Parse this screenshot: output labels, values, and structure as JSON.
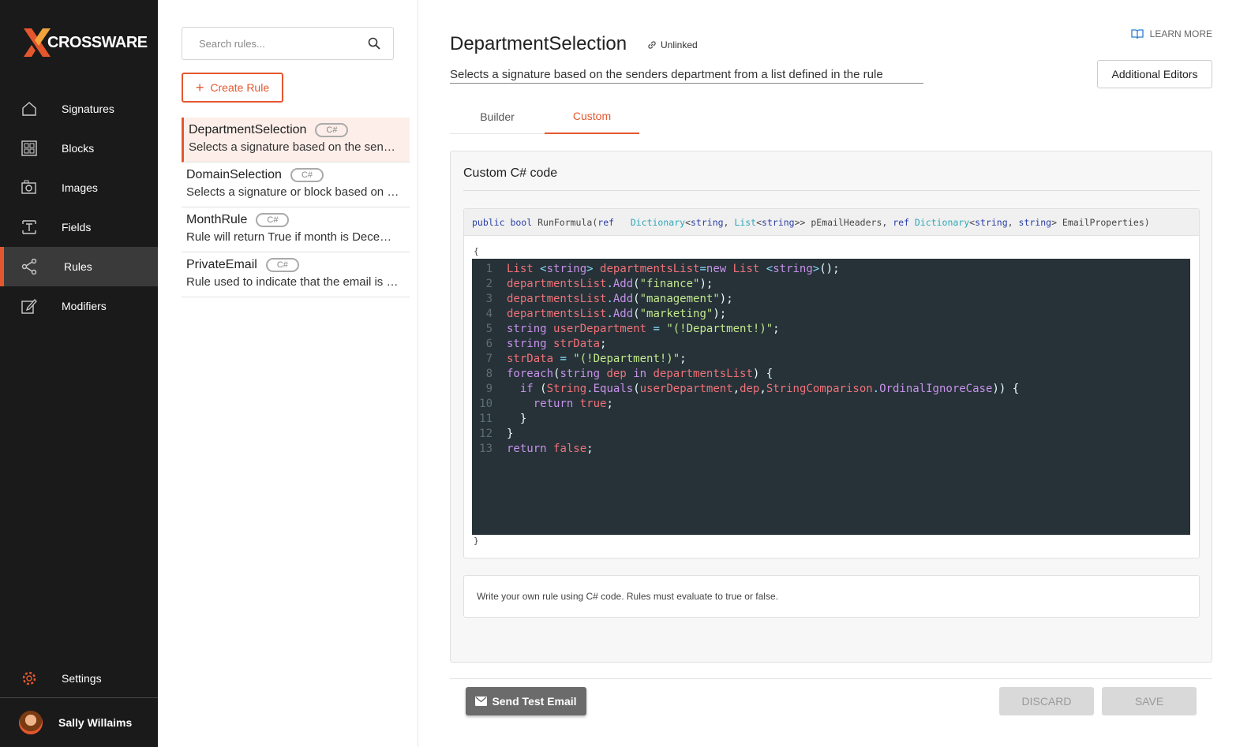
{
  "sidebar": {
    "logo_text": "CROSSWARE",
    "items": [
      {
        "label": "Signatures",
        "icon": "home-icon"
      },
      {
        "label": "Blocks",
        "icon": "blocks-icon"
      },
      {
        "label": "Images",
        "icon": "images-icon"
      },
      {
        "label": "Fields",
        "icon": "fields-icon"
      },
      {
        "label": "Rules",
        "icon": "rules-icon",
        "active": true
      },
      {
        "label": "Modifiers",
        "icon": "modifiers-icon"
      }
    ],
    "settings_label": "Settings",
    "user_name": "Sally Willaims",
    "accent_color": "#e4572e"
  },
  "rules_panel": {
    "search_placeholder": "Search rules...",
    "create_label": "Create Rule",
    "rules": [
      {
        "name": "DepartmentSelection",
        "badge": "C#",
        "desc": "Selects a signature based on the senders department from a list defined in the rule",
        "active": true
      },
      {
        "name": "DomainSelection",
        "badge": "C#",
        "desc": "Selects a signature or block based on domain"
      },
      {
        "name": "MonthRule",
        "badge": "C#",
        "desc": "Rule will return True if month is December"
      },
      {
        "name": "PrivateEmail",
        "badge": "C#",
        "desc": "Rule used to indicate that the email is private"
      }
    ]
  },
  "main": {
    "title": "DepartmentSelection",
    "link_status": "Unlinked",
    "learn_more": "LEARN MORE",
    "description": "Selects a signature based on the senders department from a list defined in the rule",
    "additional_editors": "Additional Editors",
    "tabs": [
      "Builder",
      "Custom"
    ],
    "active_tab": "Custom",
    "card_title": "Custom C# code",
    "signature": {
      "p1": "public bool",
      "p2": " RunFormula(",
      "p3": "ref",
      "p4": "   Dictionary",
      "p5": "<",
      "p6": "string",
      "p7": ", ",
      "p8": "List",
      "p9": "<",
      "p10": "string",
      "p11": ">> pEmailHeaders, ",
      "p12": "ref",
      "p13": " Dictionary",
      "p14": "<",
      "p15": "string",
      "p16": ", ",
      "p17": "string",
      "p18": "> EmailProperties)"
    },
    "open_brace": "{",
    "close_brace": "}",
    "hint": "Write your own rule using C# code. Rules must evaluate to true or false."
  },
  "footer": {
    "send_test": "Send Test Email",
    "discard": "DISCARD",
    "save": "SAVE"
  }
}
